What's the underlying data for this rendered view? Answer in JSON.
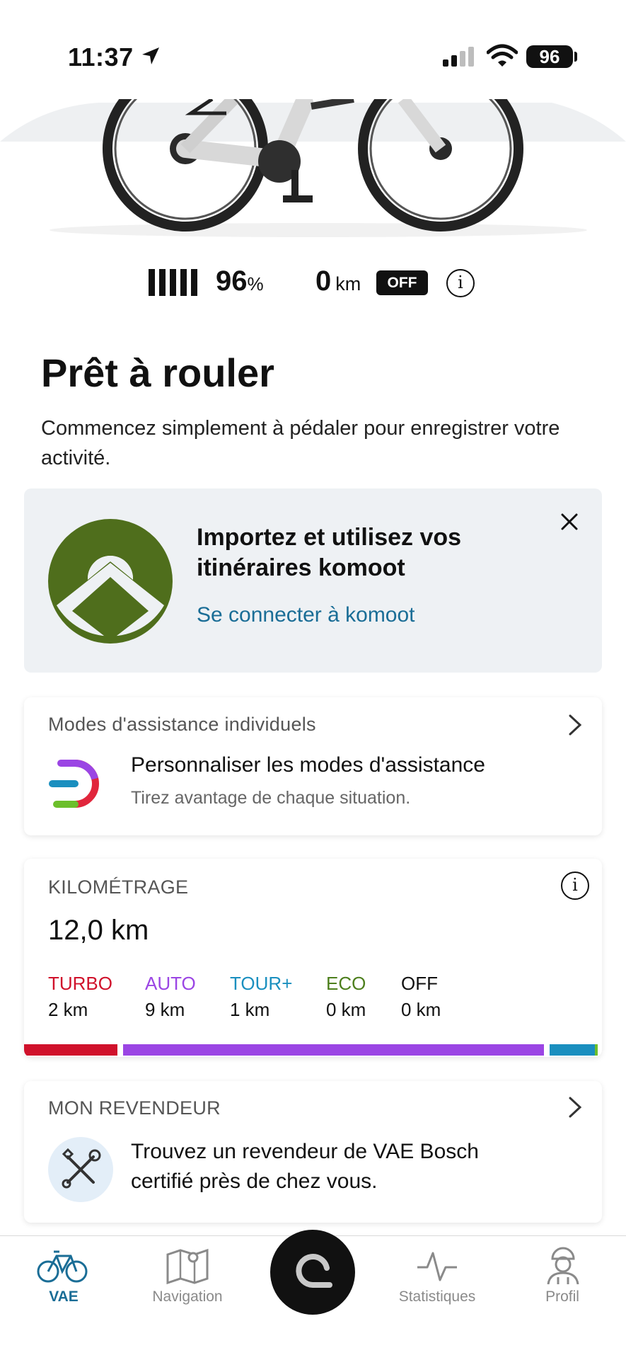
{
  "status_bar": {
    "time": "11:37",
    "battery": "96"
  },
  "bike": {
    "battery_percent": "96",
    "percent_sign": "%",
    "distance_value": "0",
    "distance_unit": "km",
    "light_state": "OFF"
  },
  "main": {
    "title": "Prêt à rouler",
    "subtitle": "Commencez simplement à pédaler pour enregistrer votre activité."
  },
  "komoot_promo": {
    "title": "Importez et utilisez vos itinéraires komoot",
    "link": "Se connecter à komoot"
  },
  "assist_card": {
    "label": "Modes d'assistance individuels",
    "title": "Personnaliser les modes d'assistance",
    "subtitle": "Tirez avantage de chaque situation."
  },
  "mileage_card": {
    "label": "KILOMÉTRAGE",
    "total": "12,0 km",
    "modes": [
      {
        "name": "TURBO",
        "value": "2 km",
        "color": "#d0112b",
        "fraction": 0.167
      },
      {
        "name": "AUTO",
        "value": "9 km",
        "color": "#9b45e4",
        "fraction": 0.75
      },
      {
        "name": "TOUR+",
        "value": "1 km",
        "color": "#1a8fbf",
        "fraction": 0.083
      },
      {
        "name": "ECO",
        "value": "0 km",
        "color": "#4d7f1d",
        "fraction": 0.0
      },
      {
        "name": "OFF",
        "value": "0 km",
        "color": "#111111",
        "fraction": 0.0
      }
    ]
  },
  "dealer_card": {
    "label": "MON REVENDEUR",
    "text": "Trouvez un revendeur de VAE Bosch certifié près de chez vous."
  },
  "tabbar": {
    "items": [
      {
        "label": "VAE",
        "icon": "bike-icon",
        "active": true
      },
      {
        "label": "Navigation",
        "icon": "map-icon",
        "active": false
      },
      {
        "label": "",
        "icon": "ride-icon",
        "active": false
      },
      {
        "label": "Statistiques",
        "icon": "pulse-icon",
        "active": false
      },
      {
        "label": "Profil",
        "icon": "cyclist-icon",
        "active": false
      }
    ]
  },
  "colors": {
    "accent": "#1a6d96",
    "komoot_green": "#4f6e1c",
    "promo_bg": "#eef1f4"
  }
}
